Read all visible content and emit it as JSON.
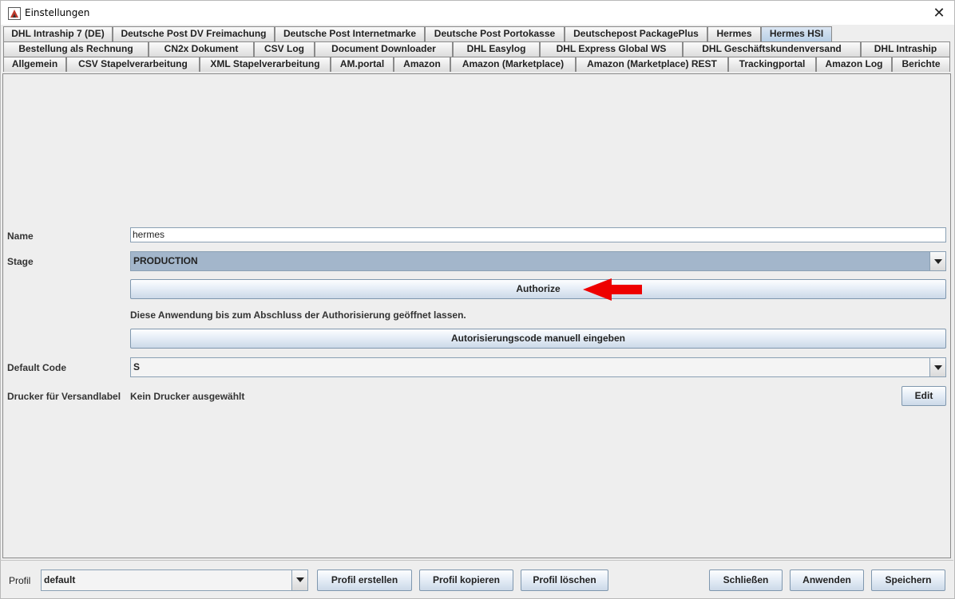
{
  "window": {
    "title": "Einstellungen",
    "close": "✕"
  },
  "tabs": {
    "row1": [
      "DHL Intraship 7 (DE)",
      "Deutsche Post DV Freimachung",
      "Deutsche Post Internetmarke",
      "Deutsche Post Portokasse",
      "Deutschepost PackagePlus",
      "Hermes",
      "Hermes HSI"
    ],
    "row2": [
      "Bestellung als Rechnung",
      "CN2x Dokument",
      "CSV Log",
      "Document Downloader",
      "DHL Easylog",
      "DHL Express Global WS",
      "DHL Geschäftskundenversand",
      "DHL Intraship"
    ],
    "row3": [
      "Allgemein",
      "CSV Stapelverarbeitung",
      "XML Stapelverarbeitung",
      "AM.portal",
      "Amazon",
      "Amazon (Marketplace)",
      "Amazon (Marketplace) REST",
      "Trackingportal",
      "Amazon Log",
      "Berichte"
    ],
    "selected": "Hermes HSI"
  },
  "form": {
    "name_label": "Name",
    "name_value": "hermes",
    "stage_label": "Stage",
    "stage_value": "PRODUCTION",
    "authorize_button": "Authorize",
    "info_text": "Diese Anwendung bis zum Abschluss der Authorisierung geöffnet lassen.",
    "manual_code_button": "Autorisierungscode manuell eingeben",
    "default_code_label": "Default Code",
    "default_code_value": "S",
    "printer_label": "Drucker für Versandlabel",
    "printer_value": "Kein Drucker ausgewählt",
    "edit_button": "Edit"
  },
  "footer": {
    "profile_label": "Profil",
    "profile_value": "default",
    "create_profile": "Profil erstellen",
    "copy_profile": "Profil kopieren",
    "delete_profile": "Profil löschen",
    "close": "Schließen",
    "apply": "Anwenden",
    "save": "Speichern"
  },
  "colors": {
    "stage_combo_bg": "#a3b6cb",
    "selected_tab": "#b8cfe6",
    "annotation_arrow": "#ee0000"
  },
  "icons": {
    "app": "app-icon",
    "close": "close-icon",
    "dropdown": "chevron-down-icon"
  }
}
